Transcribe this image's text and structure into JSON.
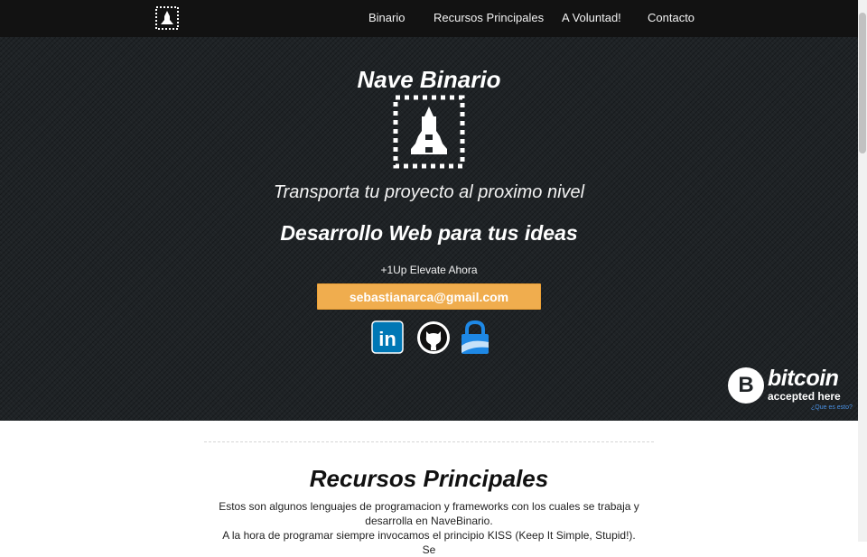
{
  "navbar": {
    "brand_icon": "rocket-logo-icon",
    "links": [
      "Binario",
      "Recursos Principales",
      "A Voluntad!",
      "Contacto"
    ]
  },
  "hero": {
    "title": "Nave Binario",
    "logo_icon": "rocket-logo-icon",
    "tagline": "Transporta tu proyecto al proximo nivel",
    "subtitle": "Desarrollo Web para tus ideas",
    "cta_label": "+1Up Elevate Ahora",
    "email_button": "sebastianarca@gmail.com",
    "social": [
      {
        "icon": "linkedin-icon",
        "label": "in"
      },
      {
        "icon": "github-icon"
      },
      {
        "icon": "keybase-lock-icon"
      }
    ]
  },
  "bitcoin": {
    "symbol": "B",
    "word": "bitcoin",
    "accepted": "accepted here",
    "link": "¿Que es esto?"
  },
  "section": {
    "title": "Recursos Principales",
    "lines": [
      "Estos son algunos lenguajes de programacion y frameworks con los cuales se trabaja y",
      "desarrolla en NaveBinario.",
      "A la hora de programar siempre invocamos el principio KISS (Keep It Simple, Stupid!). Se"
    ]
  },
  "colors": {
    "navbar_bg": "#121212",
    "hero_bg": "#1f2326",
    "accent": "#f0ad4e",
    "linkedin": "#0077b5",
    "keybase": "#1e88e5",
    "bitcoin_link": "#4a90e2"
  }
}
